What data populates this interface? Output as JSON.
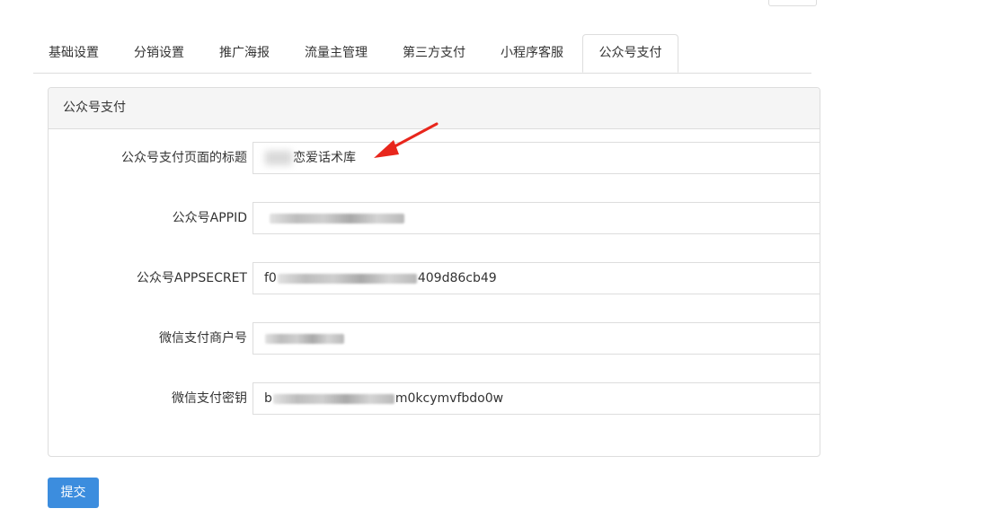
{
  "tabs": [
    {
      "label": "基础设置",
      "active": false
    },
    {
      "label": "分销设置",
      "active": false
    },
    {
      "label": "推广海报",
      "active": false
    },
    {
      "label": "流量主管理",
      "active": false
    },
    {
      "label": "第三方支付",
      "active": false
    },
    {
      "label": "小程序客服",
      "active": false
    },
    {
      "label": "公众号支付",
      "active": true
    }
  ],
  "panel": {
    "title": "公众号支付",
    "fields": [
      {
        "label": "公众号支付页面的标题",
        "value_suffix": "恋爱话术库"
      },
      {
        "label": "公众号APPID",
        "value": ""
      },
      {
        "label": "公众号APPSECRET",
        "value_prefix": "f0",
        "value_suffix": "409d86cb49"
      },
      {
        "label": "微信支付商户号",
        "value": ""
      },
      {
        "label": "微信支付密钥",
        "value_prefix": "b",
        "value_suffix": "m0kcymvfbdo0w"
      }
    ]
  },
  "submit_label": "提交",
  "colors": {
    "primary": "#3c8dde",
    "annotation_arrow": "#e8261c"
  }
}
